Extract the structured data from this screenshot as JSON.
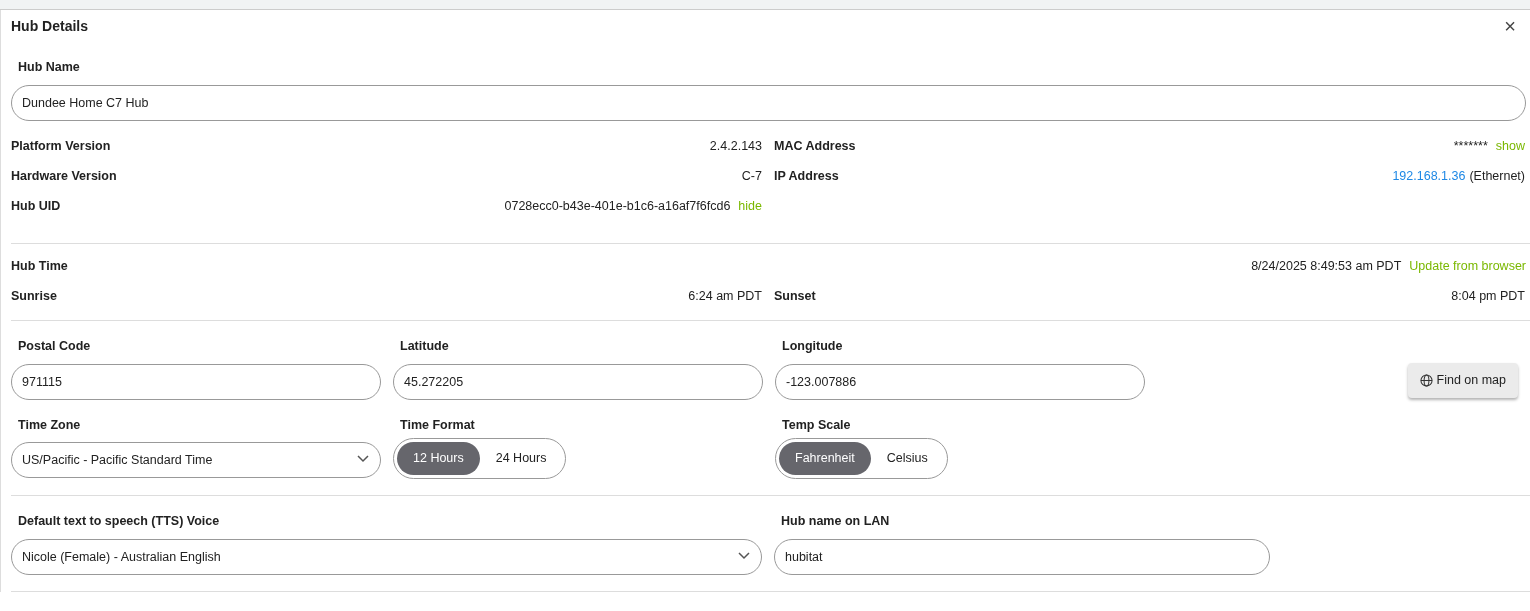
{
  "dialog": {
    "title": "Hub Details",
    "close": "×"
  },
  "hub_name": {
    "label": "Hub Name",
    "value": "Dundee Home C7 Hub"
  },
  "info_left": [
    {
      "label": "Platform Version",
      "value": "2.4.2.143"
    },
    {
      "label": "Hardware Version",
      "value": "C-7"
    },
    {
      "label": "Hub UID",
      "value": "0728ecc0-b43e-401e-b1c6-a16af7f6fcd6",
      "action": "hide"
    }
  ],
  "info_right": [
    {
      "label": "MAC Address",
      "value": "*******",
      "action": "show"
    },
    {
      "label": "IP Address",
      "link": "192.168.1.36",
      "value": "(Ethernet)"
    }
  ],
  "hub_time": {
    "label": "Hub Time",
    "value": "8/24/2025 8:49:53 am PDT",
    "action": "Update from browser"
  },
  "sun": [
    {
      "label": "Sunrise",
      "value": "6:24 am PDT"
    },
    {
      "label": "Sunset",
      "value": "8:04 pm PDT"
    }
  ],
  "location": [
    {
      "label": "Postal Code",
      "value": "971115"
    },
    {
      "label": "Latitude",
      "value": "45.272205"
    },
    {
      "label": "Longitude",
      "value": "-123.007886"
    }
  ],
  "find_button": "Find on map",
  "time_zone": {
    "label": "Time Zone",
    "value": "US/Pacific - Pacific Standard Time"
  },
  "time_format": {
    "label": "Time Format",
    "options": [
      {
        "label": "12 Hours",
        "selected": true
      },
      {
        "label": "24 Hours",
        "selected": false
      }
    ]
  },
  "temp_scale": {
    "label": "Temp Scale",
    "options": [
      {
        "label": "Fahrenheit",
        "selected": true
      },
      {
        "label": "Celsius",
        "selected": false
      }
    ]
  },
  "tts": {
    "label": "Default text to speech (TTS) Voice",
    "value": "Nicole (Female) - Australian English"
  },
  "lan_name": {
    "label": "Hub name on LAN",
    "value": "hubitat"
  }
}
